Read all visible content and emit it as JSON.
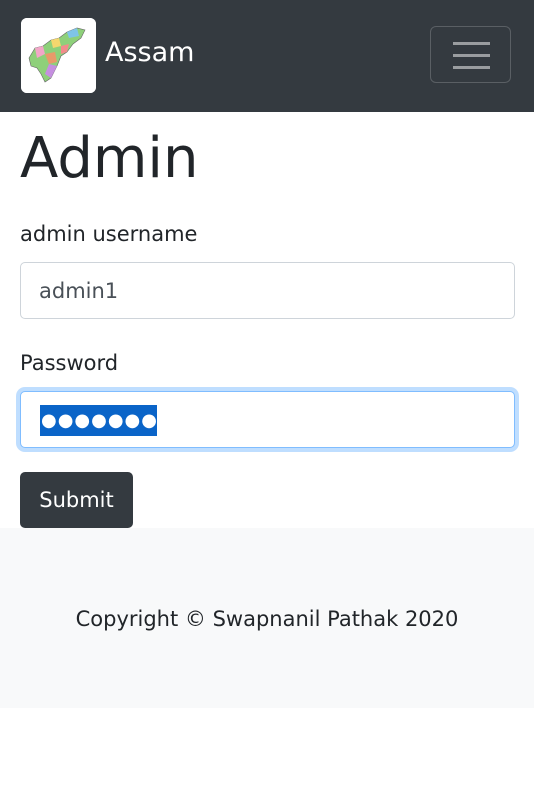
{
  "navbar": {
    "brand_text": "Assam",
    "logo_icon": "assam-map-icon",
    "toggler_icon": "hamburger-menu-icon",
    "background": "#343a40"
  },
  "main": {
    "title": "Admin",
    "username_label": "admin username",
    "username_value": "admin1",
    "password_label": "Password",
    "password_value": "●●●●●●●●",
    "submit_label": "Submit"
  },
  "footer": {
    "copyright": "Copyright © Swapnanil Pathak 2020"
  }
}
